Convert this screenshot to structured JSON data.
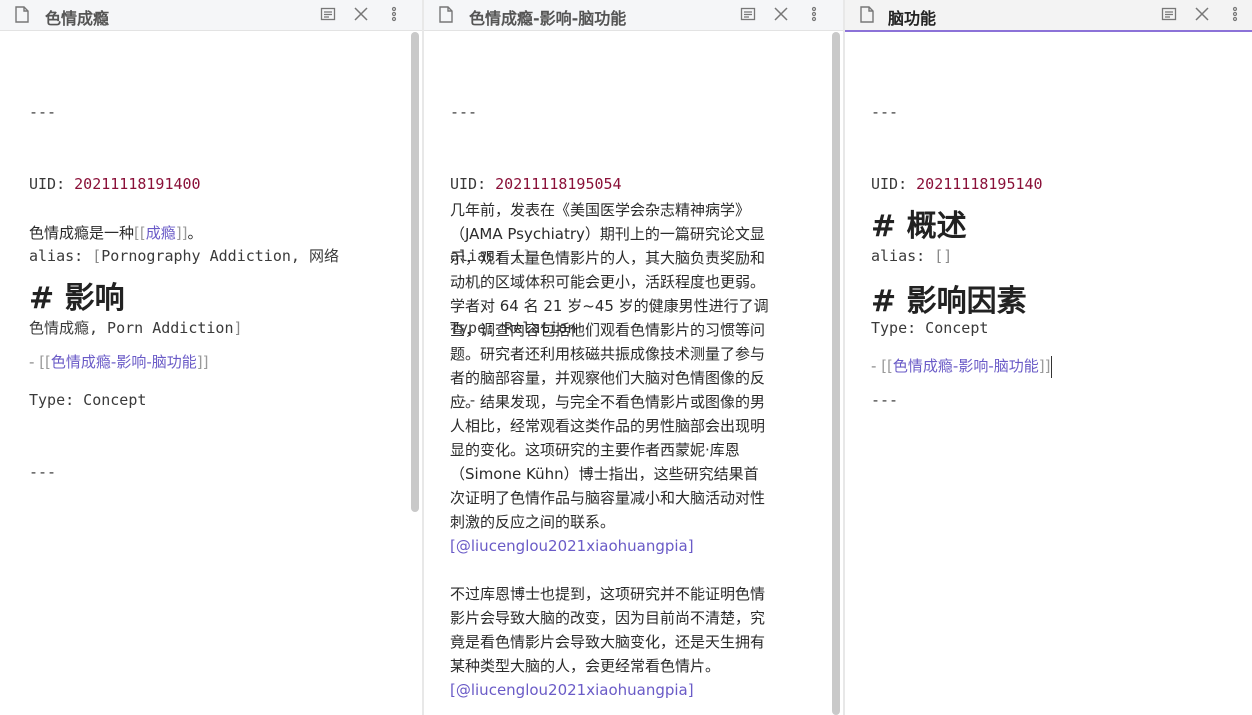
{
  "panes": [
    {
      "title": "色情成瘾",
      "frontmatter": {
        "delim_open": "---",
        "uid_key": "UID: ",
        "uid": "20211118191400",
        "alias_key": "alias: ",
        "alias_open": "[",
        "alias_value_line1": "Pornography Addiction, 网络",
        "alias_value_line2": "色情成瘾, Porn Addiction",
        "alias_close": "]",
        "type_line": "Type: Concept",
        "delim_close": "---"
      },
      "body_text_before": "色情成瘾是一种",
      "body_link_open": "[[",
      "body_link": "成瘾",
      "body_link_close": "]]",
      "body_text_after": "。",
      "heading": "# 影响",
      "list_dash": "- ",
      "list_link_open": "[[",
      "list_link": "色情成瘾-影响-脑功能",
      "list_link_close": "]]"
    },
    {
      "title": "色情成瘾-影响-脑功能",
      "frontmatter": {
        "delim_open": "---",
        "uid_key": "UID: ",
        "uid": "20211118195054",
        "alias_key": "alias: ",
        "alias_value": "[]",
        "type_line": "Type: Relation",
        "delim_close": "---"
      },
      "para1_lines": [
        "几年前，发表在《美国医学会杂志精神病学》",
        "（JAMA Psychiatry）期刊上的一篇研究论文显",
        "示，观看大量色情影片的人，其大脑负责奖励和",
        "动机的区域体积可能会更小，活跃程度也更弱。",
        "学者对 64 名 21 岁~45 岁的健康男性进行了调",
        "查，调查内容包括他们观看色情影片的习惯等问",
        "题。研究者还利用核磁共振成像技术测量了参与",
        "者的脑部容量，并观察他们大脑对色情图像的反",
        "应。结果发现，与完全不看色情影片或图像的男",
        "人相比，经常观看这类作品的男性脑部会出现明",
        "显的变化。这项研究的主要作者西蒙妮·库恩",
        "（Simone Kühn）博士指出，这些研究结果首",
        "次证明了色情作品与脑容量减小和大脑活动对性",
        "刺激的反应之间的联系。"
      ],
      "citation1": "[@liucenglou2021xiaohuangpia]",
      "para2_lines": [
        "不过库恩博士也提到，这项研究并不能证明色情",
        "影片会导致大脑的改变，因为目前尚不清楚，究",
        "竟是看色情影片会导致大脑变化，还是天生拥有",
        "某种类型大脑的人，会更经常看色情片。"
      ],
      "citation2": "[@liucenglou2021xiaohuangpia]"
    },
    {
      "title": "脑功能",
      "frontmatter": {
        "delim_open": "---",
        "uid_key": "UID: ",
        "uid": "20211118195140",
        "alias_key": "alias: ",
        "alias_value": "[]",
        "type_line": "Type: Concept",
        "delim_close": "---"
      },
      "heading1": "# 概述",
      "heading2": "# 影响因素",
      "list_dash": "- ",
      "list_link_open": "[[",
      "list_link": "色情成瘾-影响-脑功能",
      "list_link_close": "]]"
    }
  ],
  "icons": {
    "file": "file-icon",
    "reading_view": "reading-view-icon",
    "close": "close-icon",
    "more": "more-options-icon"
  },
  "colors": {
    "accent_link": "#6a5bc7",
    "uid": "#8a1038",
    "active_tab_border": "#8c72d8"
  }
}
